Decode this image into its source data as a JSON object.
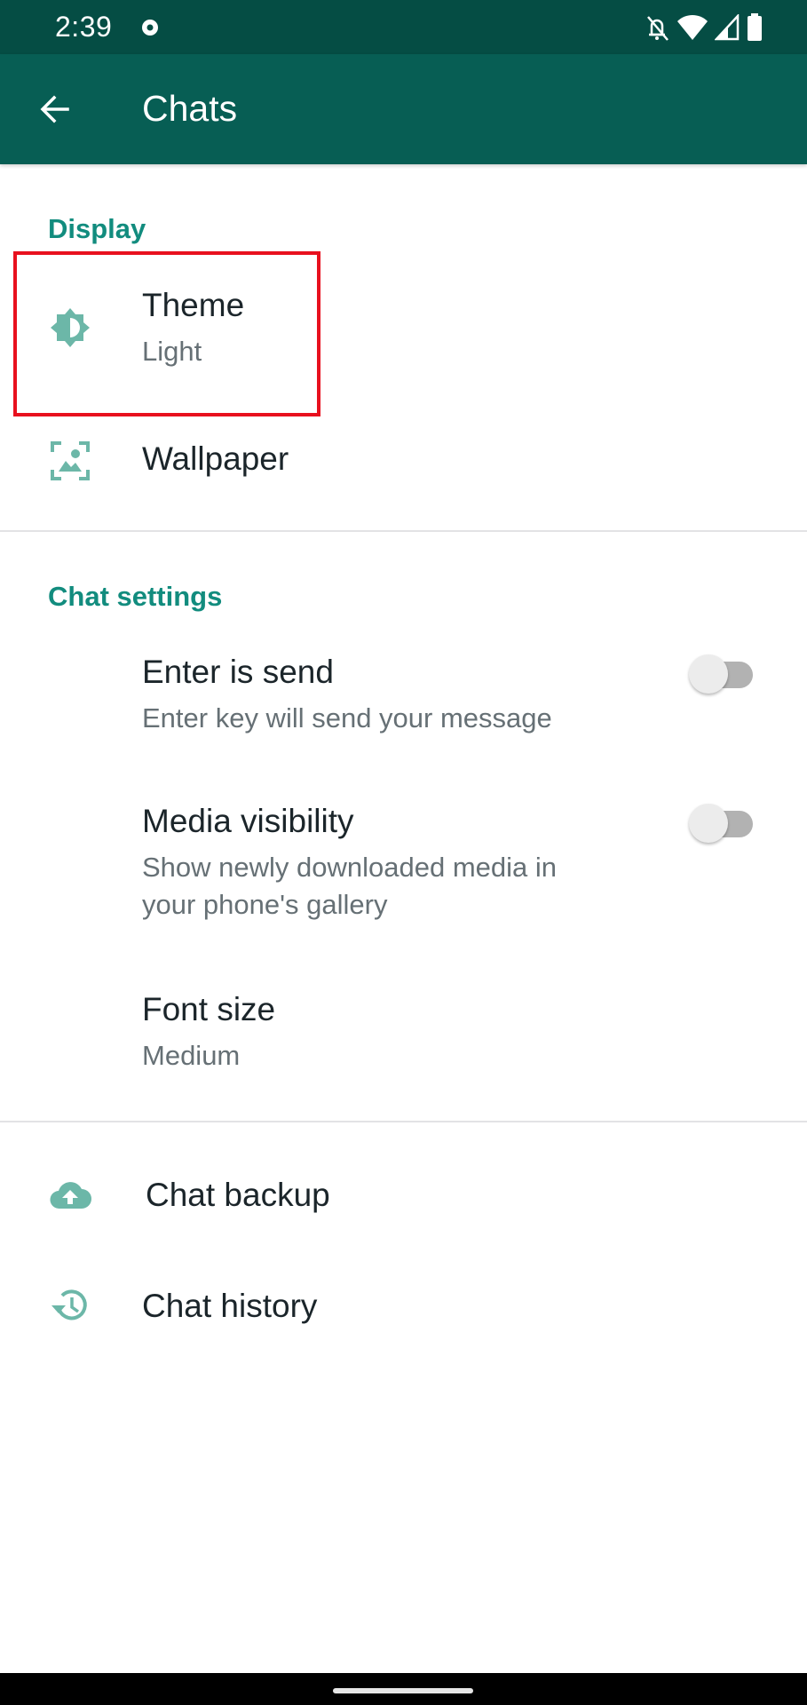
{
  "status_bar": {
    "time": "2:39",
    "icons": [
      "notification-dot-icon",
      "bell-off-icon",
      "wifi-icon",
      "signal-icon",
      "battery-icon"
    ]
  },
  "app_bar": {
    "title": "Chats",
    "back_icon": "arrow-back-icon"
  },
  "colors": {
    "status_bar": "#054d44",
    "app_bar": "#075e54",
    "accent": "#128c7e",
    "icon": "#6cb7a8",
    "highlight": "#e8101e"
  },
  "sections": {
    "display": {
      "header": "Display",
      "items": [
        {
          "icon": "brightness-icon",
          "label": "Theme",
          "value": "Light"
        },
        {
          "icon": "wallpaper-icon",
          "label": "Wallpaper"
        }
      ]
    },
    "chat_settings": {
      "header": "Chat settings",
      "items": [
        {
          "label": "Enter is send",
          "description": "Enter key will send your message",
          "toggle": false
        },
        {
          "label": "Media visibility",
          "description_line1": "Show newly downloaded media in",
          "description_line2": "your phone's gallery",
          "toggle": false
        },
        {
          "label": "Font size",
          "value": "Medium"
        }
      ]
    },
    "other": {
      "items": [
        {
          "icon": "cloud-upload-icon",
          "label": "Chat backup"
        },
        {
          "icon": "history-icon",
          "label": "Chat history"
        }
      ]
    }
  }
}
